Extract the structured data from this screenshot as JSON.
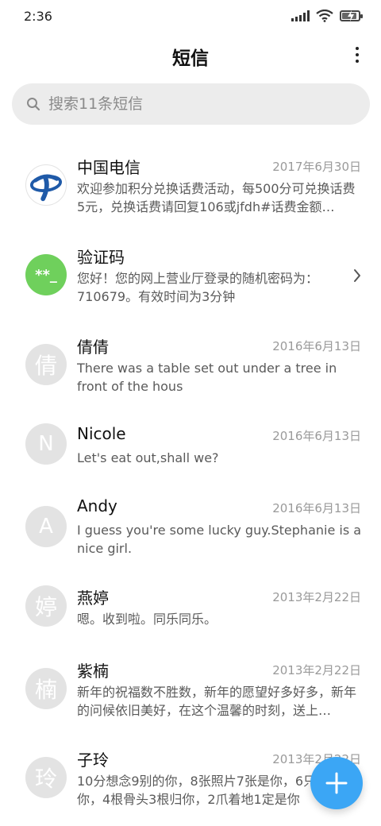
{
  "status_bar": {
    "time": "2:36",
    "battery_charging": true
  },
  "header": {
    "title": "短信",
    "more_icon": "more-vertical-icon"
  },
  "search": {
    "placeholder": "搜索11条短信"
  },
  "messages": [
    {
      "sender": "中国电信",
      "date": "2017年6月30日",
      "preview": "欢迎参加积分兑换话费活动，每500分可兑换话费5元，兑换话费请回复106或jfdh#话费金额…",
      "avatar": {
        "type": "logo",
        "icon": "china-telecom-logo",
        "color": "#1f5aa8"
      }
    },
    {
      "sender": "验证码",
      "date": "",
      "preview": "您好！您的网上营业厅登录的随机密码为：710679。有效时间为3分钟",
      "avatar": {
        "type": "text",
        "text": "**_",
        "color": "#6fd05c"
      },
      "has_chevron": true
    },
    {
      "sender": "倩倩",
      "date": "2016年6月13日",
      "preview": "There was a table set out under a tree in front of the hous",
      "avatar": {
        "type": "text",
        "text": "倩"
      }
    },
    {
      "sender": "Nicole",
      "date": "2016年6月13日",
      "preview": "Let's eat out,shall we?",
      "avatar": {
        "type": "text",
        "text": "N"
      }
    },
    {
      "sender": "Andy",
      "date": "2016年6月13日",
      "preview": "I guess you're some lucky guy.Stephanie is a nice girl.",
      "avatar": {
        "type": "text",
        "text": "A"
      }
    },
    {
      "sender": "燕婷",
      "date": "2013年2月22日",
      "preview": "嗯。收到啦。同乐同乐。",
      "avatar": {
        "type": "text",
        "text": "婷"
      }
    },
    {
      "sender": "紫楠",
      "date": "2013年2月22日",
      "preview": "新年的祝福数不胜数，新年的愿望好多好多，新年的问候依旧美好，在这个温馨的时刻，送上…",
      "avatar": {
        "type": "text",
        "text": "楠"
      }
    },
    {
      "sender": "子玲",
      "date": "2013年2月22日",
      "preview": "10分想念9别的你，8张照片7张是你，6只只像你，4根骨头3根归你，2爪着地1定是你",
      "avatar": {
        "type": "text",
        "text": "玲"
      }
    }
  ],
  "fab": {
    "icon": "plus-icon",
    "color": "#3ba6f5"
  }
}
